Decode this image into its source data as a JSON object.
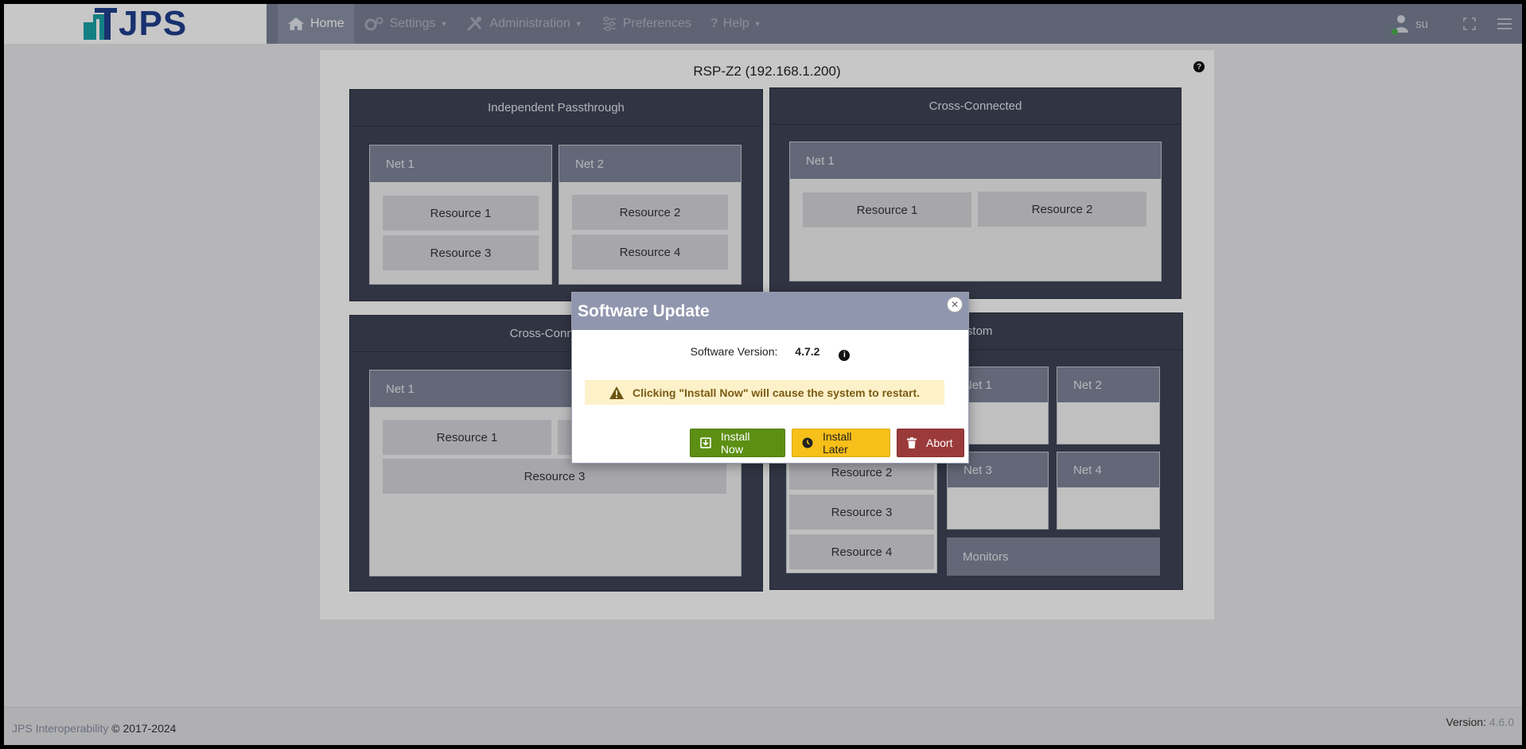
{
  "nav": {
    "logo_text": "JPS",
    "items": [
      {
        "label": "Home",
        "icon": "home-icon",
        "active": true
      },
      {
        "label": "Settings",
        "icon": "gears-icon",
        "dropdown": true
      },
      {
        "label": "Administration",
        "icon": "tools-icon",
        "dropdown": true
      },
      {
        "label": "Preferences",
        "icon": "sliders-icon"
      },
      {
        "label": "Help",
        "icon": "question-icon",
        "dropdown": true
      }
    ],
    "user": "su"
  },
  "panel": {
    "title": "RSP-Z2 (192.168.1.200)",
    "help": "?",
    "groups": {
      "independent": {
        "title": "Independent Passthrough",
        "nets": [
          {
            "name": "Net 1",
            "resources": [
              "Resource 1",
              "Resource 3"
            ]
          },
          {
            "name": "Net 2",
            "resources": [
              "Resource 2",
              "Resource 4"
            ]
          }
        ]
      },
      "cross_top": {
        "title": "Cross-Connected",
        "net": "Net 1",
        "resources": [
          "Resource 1",
          "Resource 2"
        ]
      },
      "cross_bottom": {
        "title": "Cross-Connected",
        "net": "Net 1",
        "resources": [
          "Resource 1",
          "Resource 3"
        ]
      },
      "custom": {
        "title": "ustom",
        "resources": [
          "Resource 2",
          "Resource 3",
          "Resource 4"
        ],
        "nets": [
          "Net 1",
          "Net 2",
          "Net 3",
          "Net 4"
        ],
        "monitors": "Monitors"
      }
    }
  },
  "modal": {
    "title": "Software Update",
    "version_label": "Software Version:",
    "version_value": "4.7.2",
    "warning": "Clicking \"Install Now\" will cause the system to restart.",
    "buttons": {
      "install_now": "Install Now",
      "install_later": "Install Later",
      "abort": "Abort"
    }
  },
  "footer": {
    "brand": "JPS Interoperability",
    "copyright": "© 2017-2024",
    "version_label": "Version:",
    "version_value": "4.6.0"
  },
  "colors": {
    "nav_bg": "#7a8197",
    "group_bg": "#3f4556",
    "install_now": "#5c8f14",
    "install_later": "#f6bf19",
    "abort": "#9b3a3a"
  }
}
